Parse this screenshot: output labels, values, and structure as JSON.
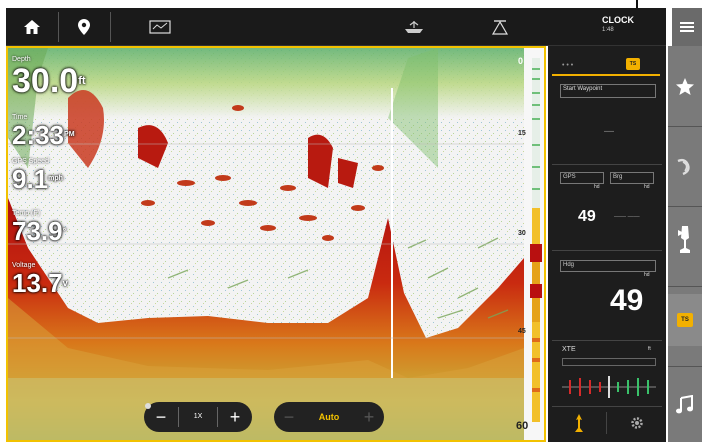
{
  "topbar": {
    "home_icon": "home-icon",
    "pin_icon": "waypoint-icon",
    "chart_icon": "chart-view-icon",
    "boat_icon": "boat-icon",
    "sonar_icon": "sonar-cone-icon",
    "clock_time": "CLOCK",
    "clock_sub": "1:48"
  },
  "sidebar": {
    "menu_icon": "menu-icon",
    "items": [
      {
        "icon": "star-icon"
      },
      {
        "icon": "sonar-sweep-icon"
      },
      {
        "icon": "motor-icon"
      },
      {
        "icon": "view-badge-icon",
        "label": "TS"
      },
      {
        "icon": "music-note-icon"
      }
    ]
  },
  "sonar": {
    "readouts": [
      {
        "label": "Depth",
        "value": "30.0",
        "unit": "ft"
      },
      {
        "label": "Time",
        "value": "2:33",
        "unit": "PM"
      },
      {
        "label": "GPS Speed",
        "value": "9.1",
        "unit": "mph"
      },
      {
        "label": "Temp (F)",
        "value": "73.9",
        "unit": "°"
      },
      {
        "label": "Voltage",
        "value": "13.7",
        "unit": "v"
      }
    ],
    "scale_ticks": [
      "0",
      "15",
      "30",
      "45",
      "60"
    ],
    "zoom": {
      "minus": "−",
      "level_label": "1X",
      "plus": "+"
    },
    "mode": {
      "minus": "−",
      "label": "Auto",
      "plus": "+"
    }
  },
  "panel": {
    "tab_dots": "• • •",
    "tab_badge": "TS",
    "nav_button": "Start Waypoint",
    "dash_value": "—",
    "field1_label": "GPS",
    "field1_sub": "hd",
    "field2_label": "Brg",
    "field2_sub": "hd",
    "value_small": "49",
    "value_small_suffix": "—— ——",
    "field3_label": "Hdg",
    "field3_sub": "hd",
    "value_big": "49",
    "xte_label": "XTE",
    "xte_unit": "ft",
    "fish_icon": "fish-icon",
    "gear_icon": "gear-icon"
  }
}
